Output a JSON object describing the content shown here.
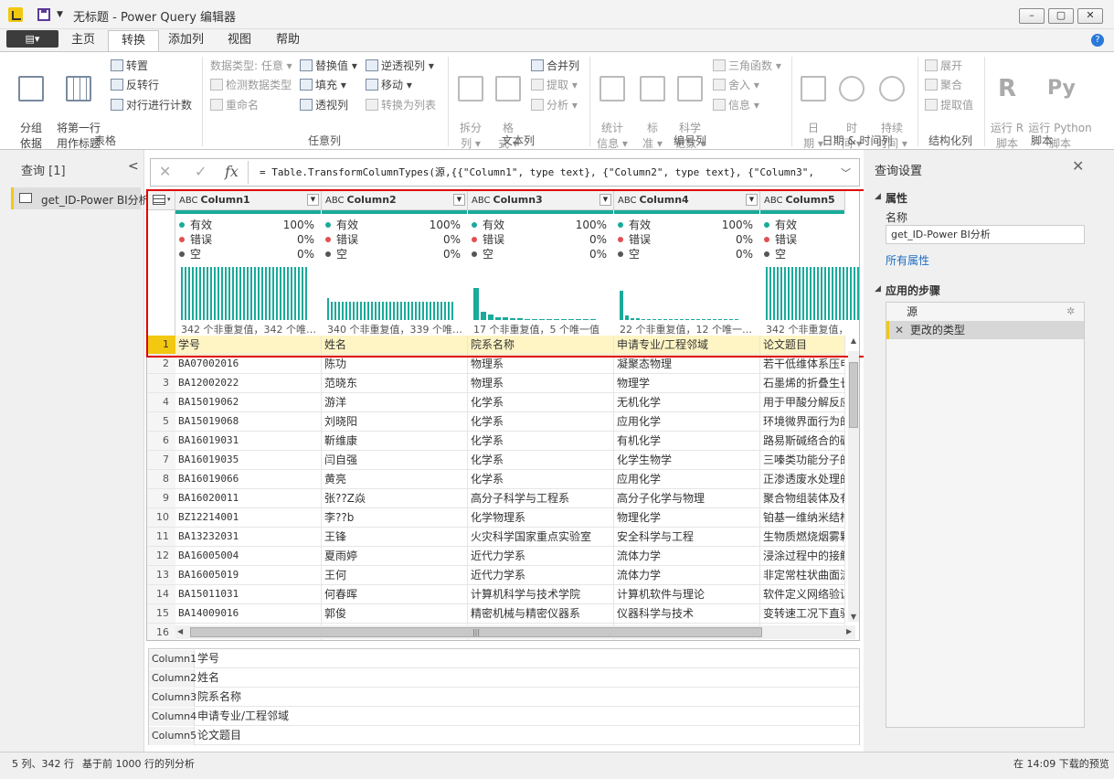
{
  "window": {
    "title": "无标题 - Power Query 编辑器",
    "min": "–",
    "max": "▢",
    "close": "✕"
  },
  "menu": {
    "file": "▤▾",
    "tabs": [
      "主页",
      "转换",
      "添加列",
      "视图",
      "帮助"
    ],
    "active_tab": "转换",
    "help": "?"
  },
  "ribbon": {
    "table_group": {
      "label": "表格",
      "group_by": "分组\n依据",
      "use_first_row": "将第一行\n用作标题",
      "transpose": "转置",
      "reverse_rows": "反转行",
      "count_rows": "对行进行计数"
    },
    "anycol_group": {
      "label": "任意列",
      "data_type": "数据类型: 任意 ▾",
      "detect_type": "检测数据类型",
      "rename": "重命名",
      "replace_values": "替换值 ▾",
      "fill": "填充 ▾",
      "pivot": "透视列",
      "unpivot": "逆透视列 ▾",
      "move": "移动 ▾",
      "to_list": "转换为列表"
    },
    "text_group": {
      "label": "文本列",
      "split": "拆分\n列 ▾",
      "format": "格\n式 ▾",
      "merge": "合并列",
      "extract": "提取 ▾",
      "parse": "分析 ▾"
    },
    "number_group": {
      "label": "编号列",
      "statistics": "统计\n信息 ▾",
      "standard": "标\n准 ▾",
      "scientific": "科学\n记数 ▾",
      "trig": "三角函数 ▾",
      "round": "舍入 ▾",
      "info": "信息 ▾"
    },
    "datetime_group": {
      "label": "日期 & 时间列",
      "date": "日\n期 ▾",
      "time": "时\n间 ▾",
      "duration": "持续\n时间 ▾"
    },
    "structured_group": {
      "label": "结构化列",
      "expand": "展开",
      "aggregate": "聚合",
      "extract_values": "提取值"
    },
    "script_group": {
      "label": "脚本",
      "run_r": "运行 R\n脚本",
      "run_python": "运行 Python\n脚本"
    }
  },
  "queries_panel": {
    "title": "查询 [1]",
    "collapse": "<",
    "items": [
      "get_ID-Power BI分析"
    ]
  },
  "formula_bar": {
    "cancel": "✕",
    "commit": "✓",
    "fx": "fx",
    "formula": "= Table.TransformColumnTypes(源,{{\"Column1\", type text}, {\"Column2\", type text}, {\"Column3\",",
    "expand": "﹀"
  },
  "colors": {
    "accent": "#1aaa9a",
    "highlight": "#e00000",
    "ribbon_active": "#f2c811",
    "valid_dot": "#1aaa9a",
    "error_dot": "#e05050",
    "empty_dot": "#555555"
  },
  "grid": {
    "type_icon": "ABC",
    "columns": [
      {
        "name": "Column1",
        "valid_label": "有效",
        "valid": "100%",
        "error_label": "错误",
        "error": "0%",
        "empty_label": "空",
        "empty": "0%",
        "distinct": "342 个非重复值，342 个唯…",
        "hist": [
          1,
          1,
          1,
          1,
          1,
          1,
          1,
          1,
          1,
          1,
          1,
          1,
          1,
          1,
          1,
          1,
          1,
          1,
          1,
          1,
          1,
          1,
          1,
          1,
          1,
          1,
          1,
          1,
          1,
          1,
          1,
          1,
          1,
          1,
          1
        ]
      },
      {
        "name": "Column2",
        "valid_label": "有效",
        "valid": "100%",
        "error_label": "错误",
        "error": "0%",
        "empty_label": "空",
        "empty": "0%",
        "distinct": "340 个非重复值，339 个唯…",
        "hist": [
          0.42,
          0.35,
          0.35,
          0.35,
          0.35,
          0.35,
          0.35,
          0.35,
          0.35,
          0.35,
          0.35,
          0.35,
          0.35,
          0.35,
          0.35,
          0.35,
          0.35,
          0.35,
          0.35,
          0.35,
          0.35,
          0.35,
          0.35,
          0.35,
          0.35,
          0.35,
          0.35,
          0.35,
          0.35,
          0.35,
          0.35,
          0.35,
          0.35,
          0.35,
          0.35
        ]
      },
      {
        "name": "Column3",
        "valid_label": "有效",
        "valid": "100%",
        "error_label": "错误",
        "error": "0%",
        "empty_label": "空",
        "empty": "0%",
        "distinct": "17 个非重复值，5 个唯一值",
        "hist": [
          0.6,
          0.16,
          0.1,
          0.06,
          0.05,
          0.04,
          0.03,
          0.02,
          0.02,
          0.01,
          0.01,
          0.01,
          0.01,
          0.01,
          0.01,
          0.01,
          0.01
        ]
      },
      {
        "name": "Column4",
        "valid_label": "有效",
        "valid": "100%",
        "error_label": "错误",
        "error": "0%",
        "empty_label": "空",
        "empty": "0%",
        "distinct": "22 个非重复值，12 个唯一…",
        "hist": [
          0.55,
          0.09,
          0.04,
          0.03,
          0.02,
          0.02,
          0.01,
          0.01,
          0.01,
          0.01,
          0.01,
          0.01,
          0.01,
          0.01,
          0.01,
          0.01,
          0.01,
          0.01,
          0.01,
          0.01,
          0.01,
          0.01
        ]
      },
      {
        "name": "Column5",
        "valid_label": "有效",
        "valid": "100%",
        "error_label": "错误",
        "error": "0%",
        "empty_label": "空",
        "empty": "0%",
        "distinct": "342 个非重复值，34",
        "hist": [
          1,
          1,
          1,
          1,
          1,
          1,
          1,
          1,
          1,
          1,
          1,
          1,
          1,
          1,
          1,
          1,
          1,
          1,
          1,
          1,
          1,
          1,
          1,
          1,
          1,
          1,
          1,
          1,
          1,
          1,
          1,
          1,
          1,
          1,
          1
        ]
      }
    ],
    "rows": [
      {
        "n": "1",
        "c": [
          "学号",
          "姓名",
          "院系名称",
          "申请专业/工程邻域",
          "论文题目"
        ]
      },
      {
        "n": "2",
        "c": [
          "BA07002016",
          "陈功",
          "物理系",
          "凝聚态物理",
          "若干低维体系压电"
        ]
      },
      {
        "n": "3",
        "c": [
          "BA12002022",
          "范晓东",
          "物理系",
          "物理学",
          "石墨烯的折叠生长"
        ]
      },
      {
        "n": "4",
        "c": [
          "BA15019062",
          "游洋",
          "化学系",
          "无机化学",
          "用于甲酸分解反应"
        ]
      },
      {
        "n": "5",
        "c": [
          "BA15019068",
          "刘晓阳",
          "化学系",
          "应用化学",
          "环境微界面行为的"
        ]
      },
      {
        "n": "6",
        "c": [
          "BA16019031",
          "靳维康",
          "化学系",
          "有机化学",
          "路易斯碱络合的硼"
        ]
      },
      {
        "n": "7",
        "c": [
          "BA16019035",
          "闫自强",
          "化学系",
          "化学生物学",
          "三嗪类功能分子的"
        ]
      },
      {
        "n": "8",
        "c": [
          "BA16019066",
          "黄亮",
          "化学系",
          "应用化学",
          "正渗透废水处理的"
        ]
      },
      {
        "n": "9",
        "c": [
          "BA16020011",
          "张??Z焱",
          "高分子科学与工程系",
          "高分子化学与物理",
          "聚合物组装体及有"
        ]
      },
      {
        "n": "10",
        "c": [
          "BZ12214001",
          "李??b",
          "化学物理系",
          "物理化学",
          "铂基一维纳米结构"
        ]
      },
      {
        "n": "11",
        "c": [
          "BA13232031",
          "王锋",
          "火灾科学国家重点实验室",
          "安全科学与工程",
          "生物质燃烧烟雾颗"
        ]
      },
      {
        "n": "12",
        "c": [
          "BA16005004",
          "夏雨婷",
          "近代力学系",
          "流体力学",
          "浸涂过程中的接触"
        ]
      },
      {
        "n": "13",
        "c": [
          "BA16005019",
          "王何",
          "近代力学系",
          "流体力学",
          "非定常柱状曲面流"
        ]
      },
      {
        "n": "14",
        "c": [
          "BA15011031",
          "何春晖",
          "计算机科学与技术学院",
          "计算机软件与理论",
          "软件定义网络验证"
        ]
      },
      {
        "n": "15",
        "c": [
          "BA14009016",
          "郭俊",
          "精密机械与精密仪器系",
          "仪器科学与技术",
          "变转速工况下直驱"
        ]
      },
      {
        "n": "16",
        "c": [
          "",
          "",
          "",
          "",
          ""
        ]
      }
    ],
    "hscroll_grip": "|||"
  },
  "detail": [
    {
      "key": "Column1",
      "value": "学号"
    },
    {
      "key": "Column2",
      "value": "姓名"
    },
    {
      "key": "Column3",
      "value": "院系名称"
    },
    {
      "key": "Column4",
      "value": "申请专业/工程邻域"
    },
    {
      "key": "Column5",
      "value": "论文题目"
    }
  ],
  "query_settings": {
    "title": "查询设置",
    "close": "✕",
    "properties_label": "属性",
    "name_label": "名称",
    "name_value": "get_ID-Power BI分析",
    "all_properties": "所有属性",
    "steps_label": "应用的步骤",
    "steps": [
      "源",
      "更改的类型"
    ],
    "step_remove": "✕",
    "step_gear": "✲",
    "collapse_arrow": "◢"
  },
  "status": {
    "cols_rows": "5 列、342 行",
    "profile_basis": "基于前 1000 行的列分析",
    "preview": "在 14:09 下载的预览"
  }
}
